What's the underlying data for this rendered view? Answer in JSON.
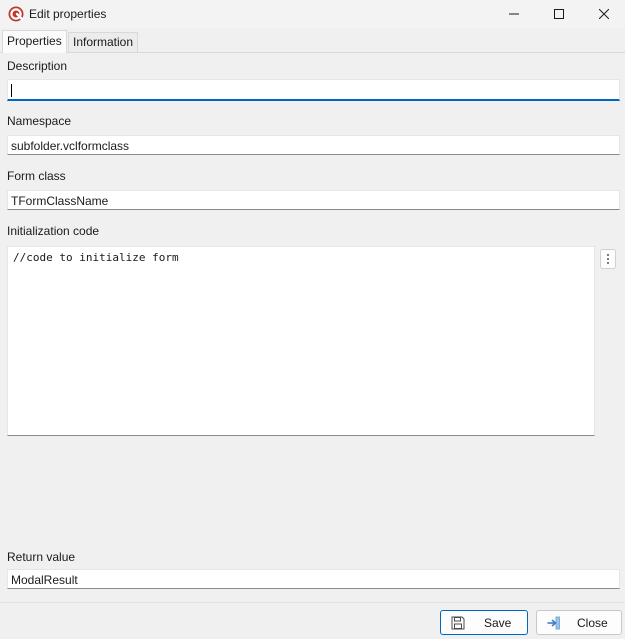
{
  "window": {
    "title": "Edit properties",
    "controls": {
      "minimize": "minimize-icon",
      "maximize": "maximize-icon",
      "close": "close-icon"
    }
  },
  "tabs": [
    {
      "label": "Properties",
      "active": true
    },
    {
      "label": "Information",
      "active": false
    }
  ],
  "fields": {
    "description": {
      "label": "Description",
      "value": ""
    },
    "namespace": {
      "label": "Namespace",
      "value": "subfolder.vclformclass"
    },
    "form_class": {
      "label": "Form class",
      "value": "TFormClassName"
    },
    "initialization_code": {
      "label": "Initialization code",
      "value": "//code to initialize form"
    },
    "return_value": {
      "label": "Return value",
      "value": "ModalResult"
    }
  },
  "buttons": {
    "save": {
      "label": "Save",
      "icon": "floppy-disk-icon"
    },
    "close": {
      "label": "Close",
      "icon": "exit-arrow-icon"
    }
  },
  "colors": {
    "accent": "#0067c0",
    "app_icon": "#c0392b"
  }
}
